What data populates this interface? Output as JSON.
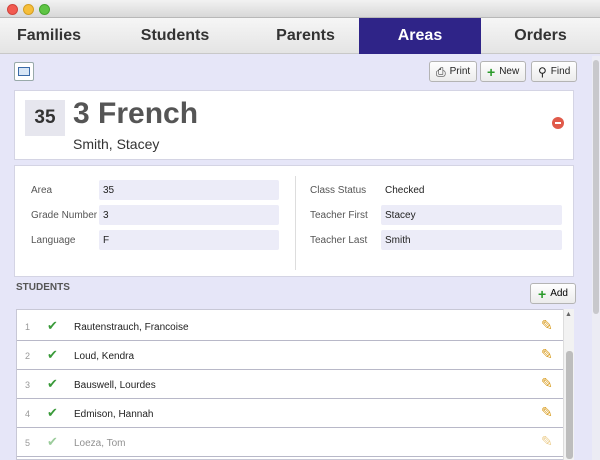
{
  "tabs": [
    {
      "label": "Families",
      "active": false
    },
    {
      "label": "Students",
      "active": false
    },
    {
      "label": "Parents",
      "active": false
    },
    {
      "label": "Areas",
      "active": true
    },
    {
      "label": "Orders",
      "active": false
    }
  ],
  "toolbar": {
    "print_label": "Print",
    "new_label": "New",
    "find_label": "Find"
  },
  "header": {
    "area_number": "35",
    "title": "3 French",
    "teacher": "Smith, Stacey"
  },
  "fields": {
    "area_label": "Area",
    "area_value": "35",
    "grade_label": "Grade Number",
    "grade_value": "3",
    "language_label": "Language",
    "language_value": "F",
    "class_status_label": "Class Status",
    "class_status_value": "Checked",
    "teacher_first_label": "Teacher First",
    "teacher_first_value": "Stacey",
    "teacher_last_label": "Teacher Last",
    "teacher_last_value": "Smith"
  },
  "students": {
    "title": "STUDENTS",
    "add_label": "Add",
    "rows": [
      {
        "num": "1",
        "name": "Rautenstrauch, Francoise"
      },
      {
        "num": "2",
        "name": "Loud, Kendra"
      },
      {
        "num": "3",
        "name": "Bauswell, Lourdes"
      },
      {
        "num": "4",
        "name": "Edmison, Hannah"
      },
      {
        "num": "5",
        "name": "Loeza, Tom"
      }
    ]
  },
  "colors": {
    "active_tab": "#2f2488",
    "background": "#e6e6f8"
  },
  "icons": {
    "view": "layout-icon",
    "print": "printer-icon",
    "new": "plus-icon",
    "find": "magnifier-icon",
    "delete": "minus-circle-icon",
    "check": "checkmark-icon",
    "edit": "pencil-icon"
  }
}
